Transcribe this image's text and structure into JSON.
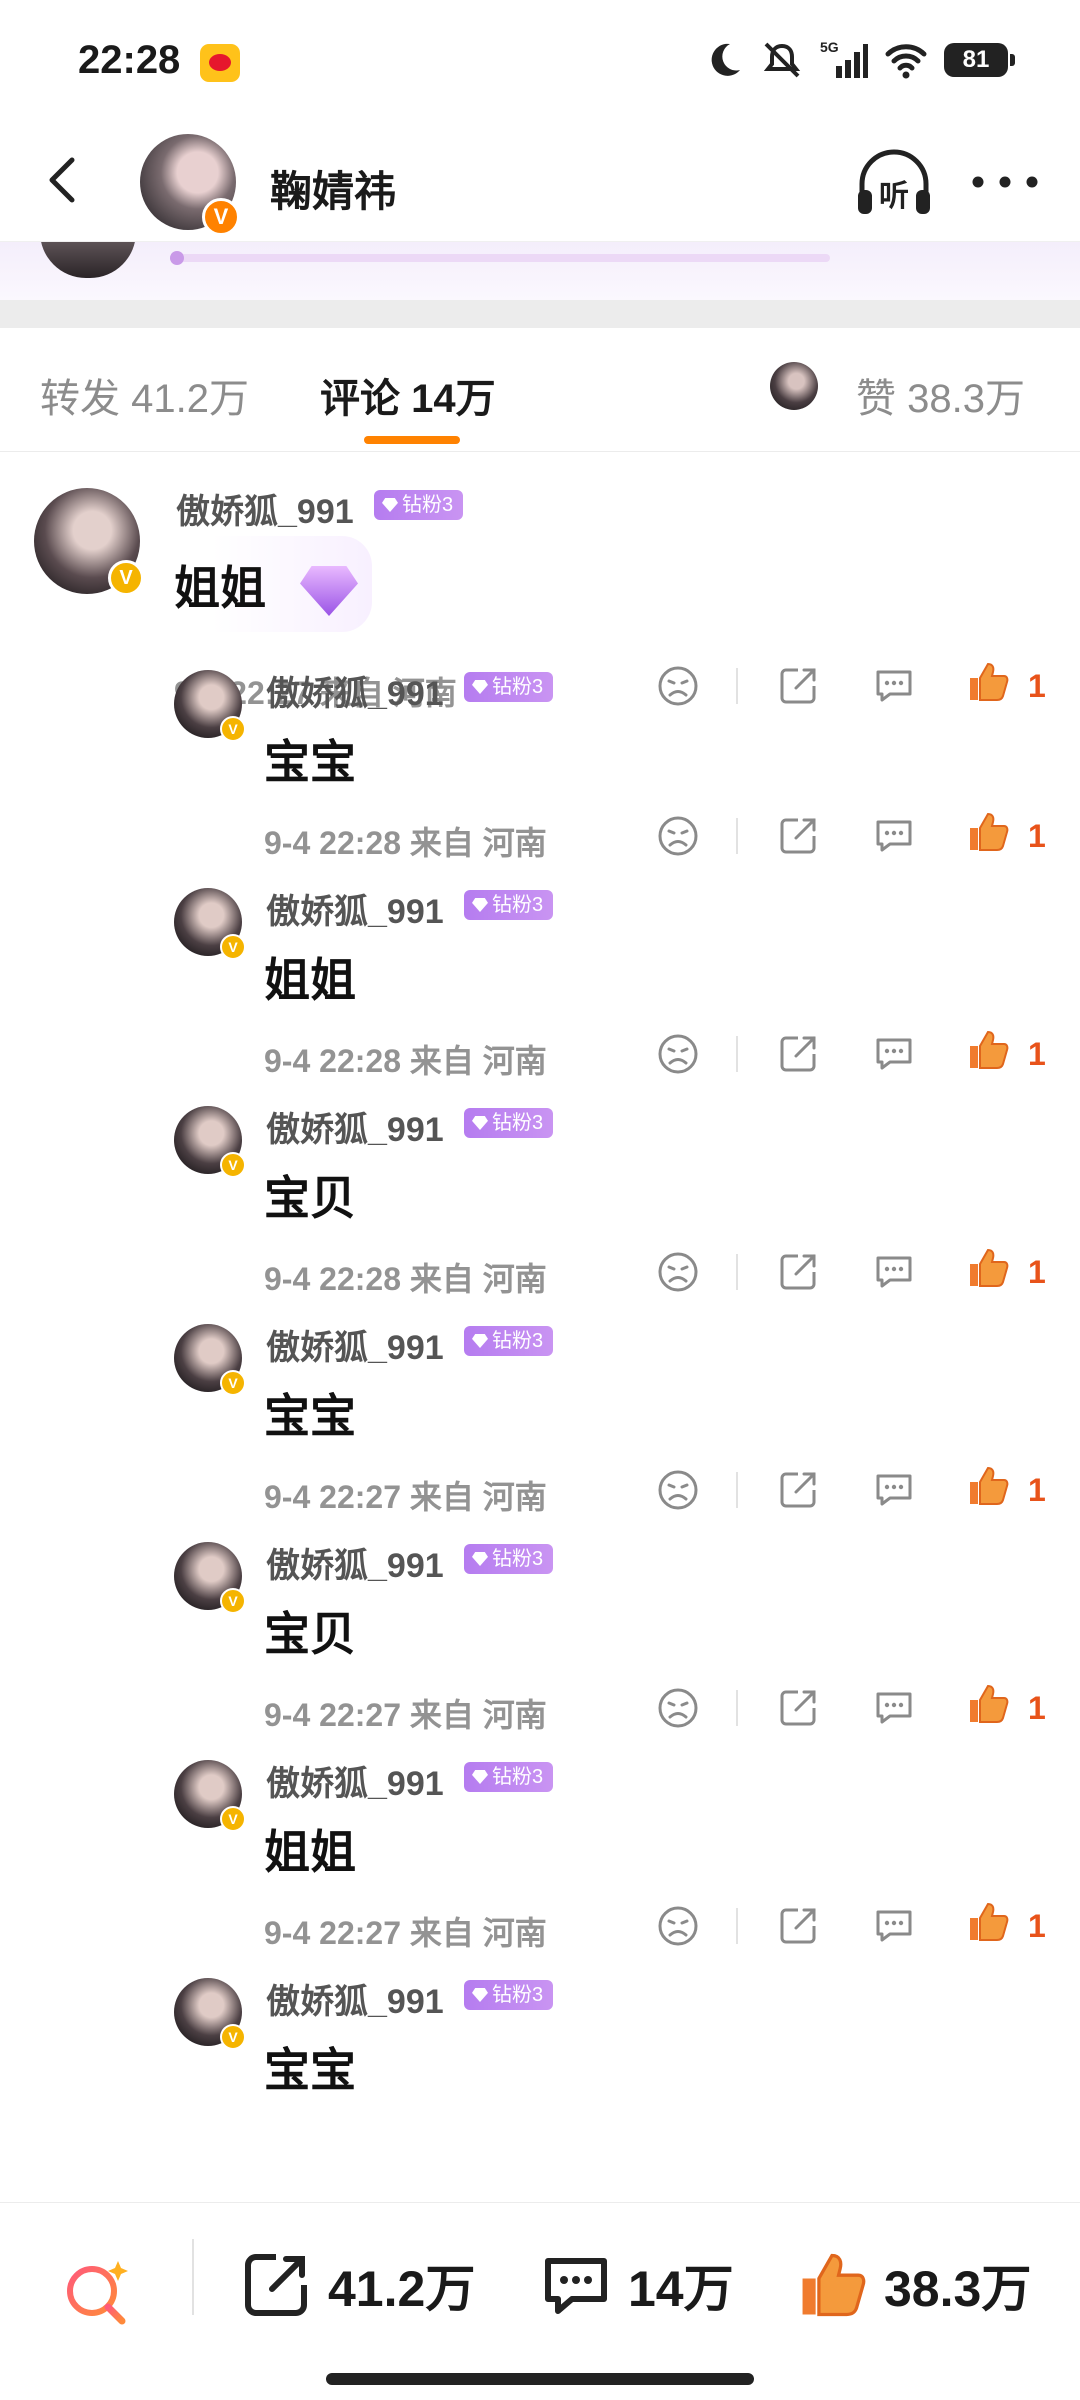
{
  "status_bar": {
    "time": "22:28",
    "battery": "81",
    "network": "5G"
  },
  "nav": {
    "title": "鞠婧祎",
    "listen_label": "听"
  },
  "tabs": {
    "repost": "转发 41.2万",
    "comments": "评论 14万",
    "likes": "赞 38.3万"
  },
  "main_comment": {
    "username": "傲娇狐_991",
    "badge": "钻粉3",
    "text": "姐姐",
    "meta": "9-4 22:27 来自 河南",
    "likes": "1"
  },
  "replies": [
    {
      "username": "傲娇狐_991",
      "badge": "钻粉3",
      "text": "宝宝",
      "meta": "9-4 22:28 来自 河南",
      "likes": "1"
    },
    {
      "username": "傲娇狐_991",
      "badge": "钻粉3",
      "text": "姐姐",
      "meta": "9-4 22:28 来自 河南",
      "likes": "1"
    },
    {
      "username": "傲娇狐_991",
      "badge": "钻粉3",
      "text": "宝贝",
      "meta": "9-4 22:28 来自 河南",
      "likes": "1"
    },
    {
      "username": "傲娇狐_991",
      "badge": "钻粉3",
      "text": "宝宝",
      "meta": "9-4 22:27 来自 河南",
      "likes": "1"
    },
    {
      "username": "傲娇狐_991",
      "badge": "钻粉3",
      "text": "宝贝",
      "meta": "9-4 22:27 来自 河南",
      "likes": "1"
    },
    {
      "username": "傲娇狐_991",
      "badge": "钻粉3",
      "text": "姐姐",
      "meta": "9-4 22:27 来自 河南",
      "likes": "1"
    },
    {
      "username": "傲娇狐_991",
      "badge": "钻粉3",
      "text": "宝宝",
      "meta": "",
      "likes": ""
    }
  ],
  "bottom_bar": {
    "reposts": "41.2万",
    "comments": "14万",
    "likes": "38.3万"
  },
  "colors": {
    "accent": "#ff8200",
    "like": "#e8531a",
    "badge": "#b57cf0"
  }
}
